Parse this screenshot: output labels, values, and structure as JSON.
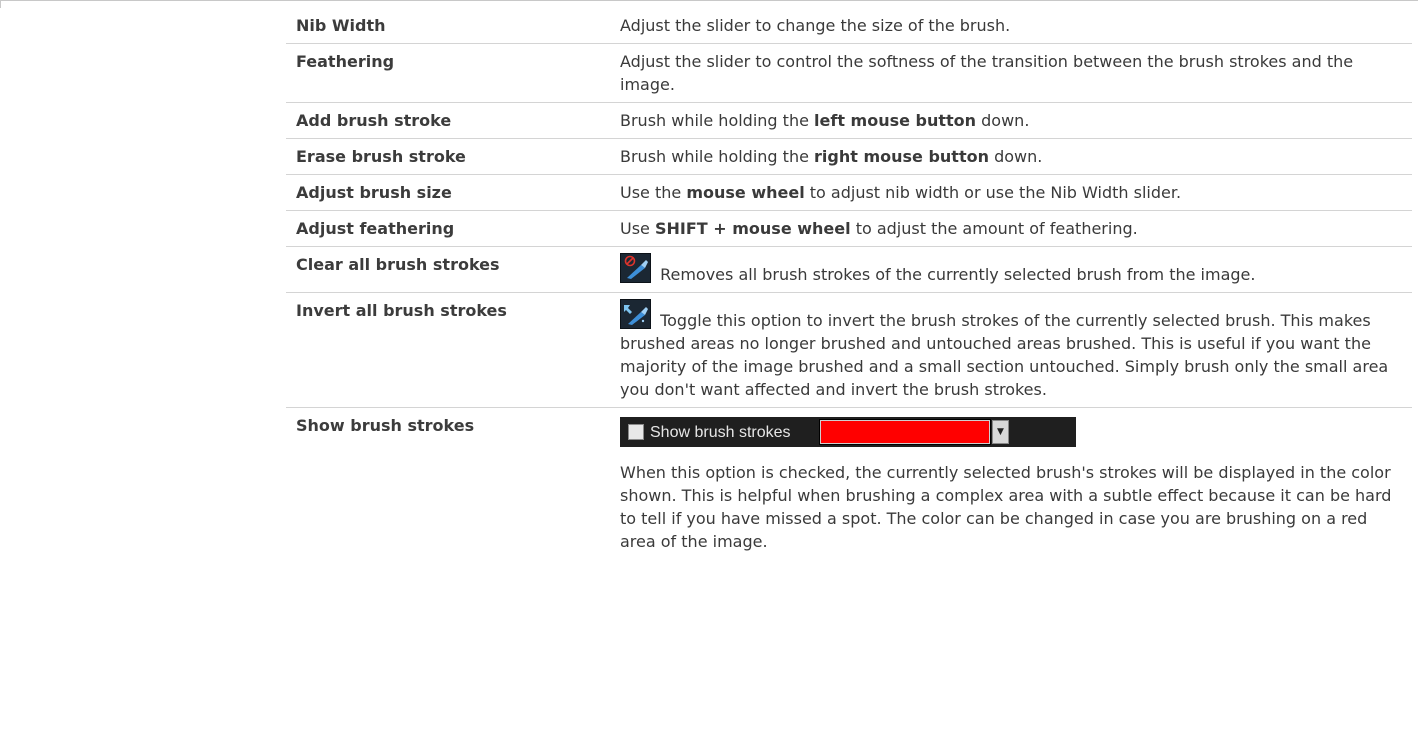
{
  "rows": [
    {
      "term": "Nib Width",
      "desc": [
        {
          "t": "Adjust the slider to change the size of the brush."
        }
      ]
    },
    {
      "term": "Feathering",
      "desc": [
        {
          "t": "Adjust the slider to control the softness of the transition between the brush strokes and the image."
        }
      ]
    },
    {
      "term": "Add brush stroke",
      "desc": [
        {
          "t": "Brush while holding the "
        },
        {
          "t": "left mouse button",
          "b": true
        },
        {
          "t": " down."
        }
      ]
    },
    {
      "term": "Erase brush stroke",
      "desc": [
        {
          "t": "Brush while holding the "
        },
        {
          "t": "right mouse button",
          "b": true
        },
        {
          "t": " down."
        }
      ]
    },
    {
      "term": "Adjust brush size",
      "desc": [
        {
          "t": "Use the "
        },
        {
          "t": "mouse wheel",
          "b": true
        },
        {
          "t": " to adjust nib width or use the Nib Width slider."
        }
      ]
    },
    {
      "term": "Adjust feathering",
      "desc": [
        {
          "t": "Use "
        },
        {
          "t": "SHIFT + mouse wheel",
          "b": true
        },
        {
          "t": " to adjust the amount of feathering."
        }
      ]
    },
    {
      "term": "Clear all brush strokes",
      "icon": "clear-brush-icon",
      "desc": [
        {
          "t": " Removes all brush strokes of the currently selected brush from the image."
        }
      ]
    },
    {
      "term": "Invert all brush strokes",
      "icon": "invert-brush-icon",
      "desc": [
        {
          "t": " Toggle this option to invert the brush strokes of the currently selected brush. This makes brushed areas no longer brushed and untouched areas brushed. This is useful if you want the majority of the image brushed and a small section untouched. Simply brush only the small area you don't want affected and invert the brush strokes."
        }
      ]
    },
    {
      "term": "Show brush strokes",
      "control": {
        "checkbox_label": "Show brush strokes",
        "checked": false,
        "swatch_color": "#ff0000"
      },
      "desc": [
        {
          "t": "When this option is checked, the currently selected brush's strokes will be displayed in the color shown. This is helpful when brushing a complex area with a subtle effect because it can be hard to tell if you have missed a spot. The color can be changed in case you are brushing on a red area of the image."
        }
      ]
    }
  ]
}
